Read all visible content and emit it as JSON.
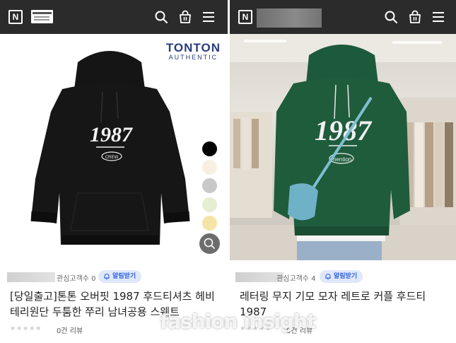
{
  "left_product": {
    "brand_logo_text": "TONTON",
    "brand_logo_sub": "AUTHENTIC",
    "hoodie_print": "1987",
    "hoodie_patch": "CREW",
    "hoodie_color": "#141414",
    "color_swatches": [
      "#000000",
      "#f7f0e1",
      "#c8c8c8",
      "#e6eed2",
      "#f5e4a6"
    ],
    "interest_label": "관심고객수 0",
    "alarm_button": "알림받기",
    "title": "[당일출고]톤톤 오버핏 1987 후드티셔츠 헤비 테리원단 두툼한 쭈리 남녀공용 스웨트",
    "review_count": "0건 리뷰"
  },
  "right_product": {
    "hoodie_print": "1987",
    "hoodie_patch": "mention",
    "hoodie_color": "#1f5c3c",
    "interest_label": "관심고객수 4",
    "alarm_button": "알림받기",
    "title": "레터링 무지 기모 모자 레트로 커플 후드티 1987",
    "review_count": "0건 리뷰"
  },
  "watermark": "fashion insight",
  "icons": {
    "logo": "naver-n-icon",
    "search": "search-icon",
    "cart": "shopping-bag-icon",
    "menu": "hamburger-menu-icon",
    "zoom": "zoom-search-icon",
    "bell": "bell-icon"
  }
}
